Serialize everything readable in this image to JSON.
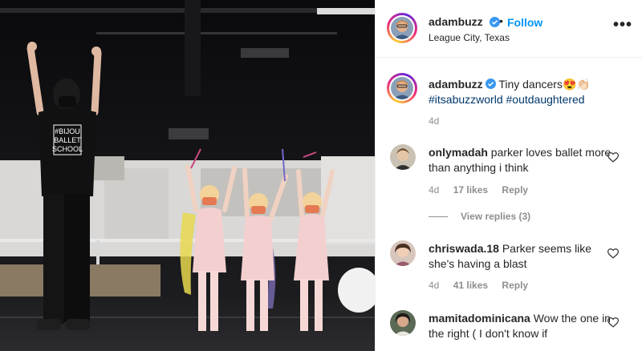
{
  "post": {
    "author": "adambuzz",
    "follow_label": "Follow",
    "separator": "•",
    "location": "League City, Texas",
    "more_label": "•••",
    "caption_text": "Tiny dancers😍👏🏻",
    "hashtags": [
      "#itsabuzzworld",
      "#outdaughtered"
    ],
    "caption_age": "4d",
    "photo_alt": "Ballet instructor in #BIJOU BALLET SCHOOL shirt with three small dancers holding ribbons",
    "shirt_text": [
      "#BIJOU",
      "BALLET",
      "SCHOOL"
    ]
  },
  "comments": [
    {
      "user": "onlymadah",
      "text": "parker loves ballet more than anything i think",
      "age": "4d",
      "likes": "17 likes",
      "reply_label": "Reply",
      "view_replies": "View replies (3)"
    },
    {
      "user": "chriswada.18",
      "text": "Parker seems like she's having a blast",
      "age": "4d",
      "likes": "41 likes",
      "reply_label": "Reply"
    },
    {
      "user": "mamitadominicana",
      "text": "Wow the one in the right ( I don't know if"
    }
  ],
  "colors": {
    "link": "#0095f6",
    "hashtag": "#00376b",
    "muted": "#8e8e8e",
    "verified": "#3897f0"
  },
  "icons": {
    "more": "more-icon",
    "verified": "verified-badge-icon",
    "like": "heart-icon"
  }
}
